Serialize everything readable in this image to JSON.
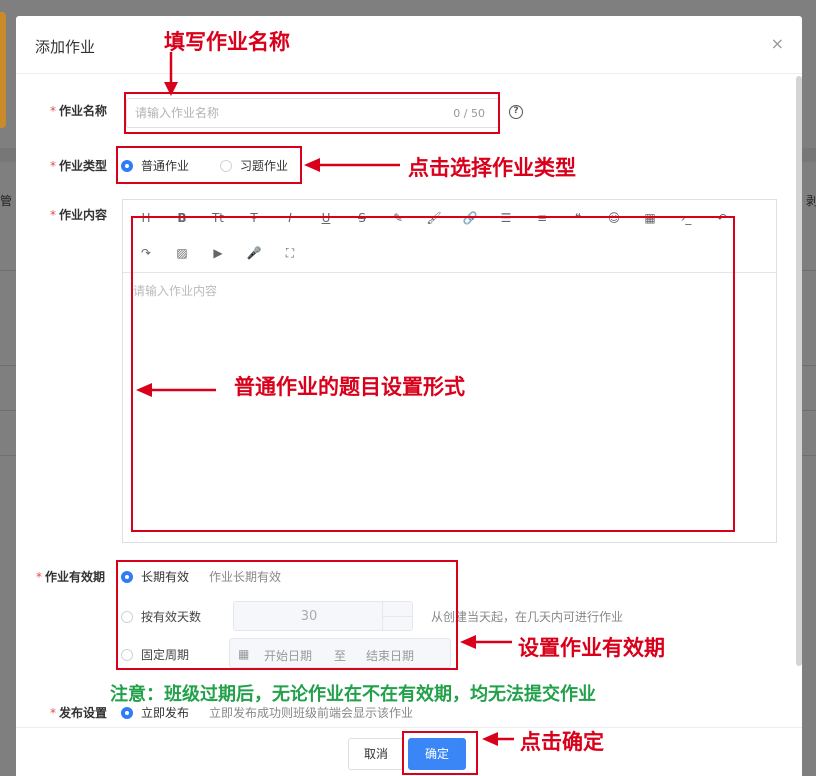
{
  "background": {
    "left_text": "管",
    "right_text": "剥"
  },
  "dialog": {
    "title": "添加作业",
    "close_glyph": "×"
  },
  "form": {
    "name": {
      "label": "作业名称",
      "placeholder": "请输入作业名称",
      "counter": "0 / 50",
      "help_glyph": "?"
    },
    "type": {
      "label": "作业类型",
      "options": [
        {
          "label": "普通作业",
          "selected": true
        },
        {
          "label": "习题作业",
          "selected": false
        }
      ]
    },
    "content": {
      "label": "作业内容",
      "placeholder": "请输入作业内容",
      "toolbar_row1": [
        "H",
        "B",
        "Tt",
        "Ŧ",
        "I",
        "U",
        "S",
        "✎",
        "🖌",
        "🔗",
        "☰",
        "≡",
        "❝",
        "☺",
        "▦",
        "›_",
        "↶"
      ],
      "toolbar_row2": [
        "↷",
        "▨",
        "▶",
        "🎤",
        "⛶"
      ]
    },
    "validity": {
      "label": "作业有效期",
      "long_term": {
        "label": "长期有效",
        "hint": "作业长期有效",
        "selected": true
      },
      "by_days": {
        "label": "按有效天数",
        "value": "30",
        "hint": "从创建当天起，在几天内可进行作业",
        "selected": false
      },
      "fixed_period": {
        "label": "固定周期",
        "start_placeholder": "开始日期",
        "separator": "至",
        "end_placeholder": "结束日期",
        "selected": false
      }
    },
    "publish": {
      "label": "发布设置",
      "option": "立即发布",
      "hint": "立即发布成功则班级前端会显示该作业"
    }
  },
  "footer": {
    "cancel_label": "取消",
    "ok_label": "确定"
  },
  "annotations": {
    "fill_name": "填写作业名称",
    "choose_type": "点击选择作业类型",
    "question_format": "普通作业的题目设置形式",
    "set_validity": "设置作业有效期",
    "note": "注意：班级过期后，无论作业在不在有效期，均无法提交作业",
    "click_ok": "点击确定"
  },
  "colors": {
    "primary": "#3b86f7",
    "annotation_red": "#d9001b",
    "annotation_green": "#22a04a",
    "required": "#e34d4d"
  }
}
